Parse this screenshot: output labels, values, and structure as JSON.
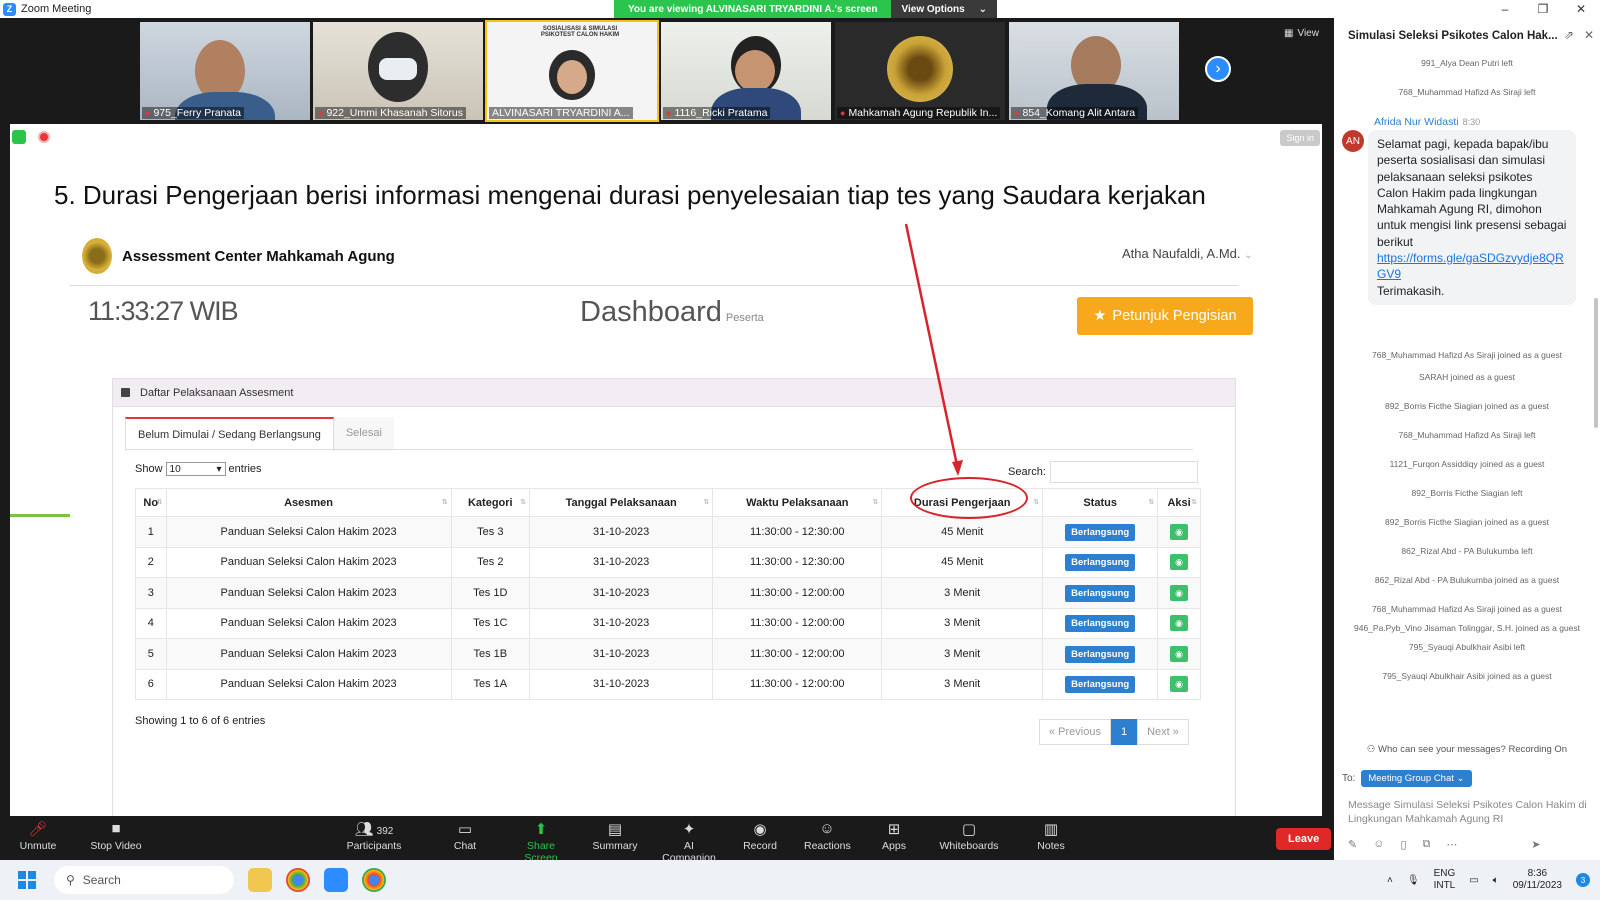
{
  "window": {
    "title": "Zoom Meeting",
    "minimize": "–",
    "maximize": "❐",
    "close": "✕"
  },
  "banner": {
    "viewing": "You are viewing ALVINASARI TRYARDINI A.'s screen",
    "view_options": "View Options",
    "chevron": "⌄"
  },
  "gallery": {
    "view_label": "View",
    "participants": [
      {
        "name": "975_Ferry Pranata",
        "muted": true
      },
      {
        "name": "922_Ummi Khasanah Sitorus",
        "muted": true
      },
      {
        "name": "ALVINASARI TRYARDINI A...",
        "muted": false,
        "active": true
      },
      {
        "name": "1116_Ricki Pratama",
        "muted": true
      },
      {
        "name": "Mahkamah Agung Republik In...",
        "muted": true
      },
      {
        "name": "854_Komang Alit Antara",
        "muted": true
      }
    ],
    "tile_text": "SOSIALISASI & SIMULASI PSIKOTEST CALON HAKIM",
    "next_glyph": "›"
  },
  "share": {
    "signin": "Sign in",
    "slide_title": "5. Durasi Pengerjaan berisi informasi mengenai durasi penyelesaian tiap tes yang Saudara kerjakan",
    "app_title": "Assessment Center Mahkamah Agung",
    "user": "Atha Naufaldi, A.Md.",
    "user_chevron": "⌄",
    "clock": "11:33:27 WIB",
    "dashboard": "Dashboard",
    "dashboard_sub": "Peserta",
    "petunjuk": "Petunjuk Pengisian",
    "petunjuk_icon": "★",
    "panel_title": "Daftar Pelaksanaan Assesment",
    "tab_active": "Belum Dimulai / Sedang Berlangsung",
    "tab_inactive": "Selesai",
    "show": "Show",
    "show_value": "10",
    "entries": "entries",
    "search": "Search:",
    "columns": [
      "No",
      "Asesmen",
      "Kategori",
      "Tanggal Pelaksanaan",
      "Waktu Pelaksanaan",
      "Durasi Pengerjaan",
      "Status",
      "Aksi"
    ],
    "rows": [
      [
        "1",
        "Panduan Seleksi Calon Hakim 2023",
        "Tes 3",
        "31-10-2023",
        "11:30:00 - 12:30:00",
        "45 Menit",
        "Berlangsung"
      ],
      [
        "2",
        "Panduan Seleksi Calon Hakim 2023",
        "Tes 2",
        "31-10-2023",
        "11:30:00 - 12:30:00",
        "45 Menit",
        "Berlangsung"
      ],
      [
        "3",
        "Panduan Seleksi Calon Hakim 2023",
        "Tes 1D",
        "31-10-2023",
        "11:30:00 - 12:00:00",
        "3 Menit",
        "Berlangsung"
      ],
      [
        "4",
        "Panduan Seleksi Calon Hakim 2023",
        "Tes 1C",
        "31-10-2023",
        "11:30:00 - 12:00:00",
        "3 Menit",
        "Berlangsung"
      ],
      [
        "5",
        "Panduan Seleksi Calon Hakim 2023",
        "Tes 1B",
        "31-10-2023",
        "11:30:00 - 12:00:00",
        "3 Menit",
        "Berlangsung"
      ],
      [
        "6",
        "Panduan Seleksi Calon Hakim 2023",
        "Tes 1A",
        "31-10-2023",
        "11:30:00 - 12:00:00",
        "3 Menit",
        "Berlangsung"
      ]
    ],
    "showing": "Showing 1 to 6 of 6 entries",
    "prev": "« Previous",
    "page": "1",
    "next": "Next »"
  },
  "toolbar": {
    "unmute": "Unmute",
    "stop_video": "Stop Video",
    "participants": "Participants",
    "participant_count": "392",
    "chat": "Chat",
    "share_screen": "Share Screen",
    "summary": "Summary",
    "ai_companion": "AI Companion",
    "record": "Record",
    "reactions": "Reactions",
    "apps": "Apps",
    "whiteboards": "Whiteboards",
    "notes": "Notes",
    "leave": "Leave"
  },
  "chat": {
    "title": "Simulasi Seleksi Psikotes Calon Hak...",
    "system_top": [
      "991_Alya Dean Putri left",
      "768_Muhammad Hafizd As Siraji left"
    ],
    "sender": "Afrida Nur Widasti",
    "sender_time": "8:30",
    "avatar": "AN",
    "message": "Selamat pagi, kepada bapak/ibu peserta sosialisasi dan simulasi pelaksanaan seleksi psikotes Calon Hakim pada lingkungan Mahkamah Agung RI, dimohon untuk mengisi link presensi sebagai berikut",
    "link": "https://forms.gle/gaSDGzvydje8QRGV9",
    "thanks": "Terimakasih.",
    "system_after": [
      "768_Muhammad Hafizd As Siraji joined as a guest",
      "SARAH joined as a guest",
      "892_Borris Ficthe Siagian joined as a guest",
      "768_Muhammad Hafizd As Siraji left",
      "1121_Furqon Assiddiqy joined as a guest",
      "892_Borris Ficthe Siagian left",
      "892_Borris Ficthe Siagian joined as a guest",
      "862_Rizal Abd - PA Bulukumba left",
      "862_Rizal Abd - PA Bulukumba joined as a guest",
      "768_Muhammad Hafizd As Siraji joined as a guest",
      "946_Pa.Pyb_Vino Jisaman Tolinggar, S.H. joined as a guest",
      "795_Syauqi Abulkhair Asibi left",
      "795_Syauqi Abulkhair Asibi joined as a guest"
    ],
    "who_can_see": "Who can see your messages? Recording On",
    "to": "To:",
    "to_value": "Meeting Group Chat ⌄",
    "placeholder": "Message Simulasi Seleksi Psikotes Calon Hakim di Lingkungan Mahkamah Agung RI"
  },
  "taskbar": {
    "search": "Search",
    "lang1": "ENG",
    "lang2": "INTL",
    "time": "8:36",
    "date": "09/11/2023",
    "notif": "3"
  }
}
